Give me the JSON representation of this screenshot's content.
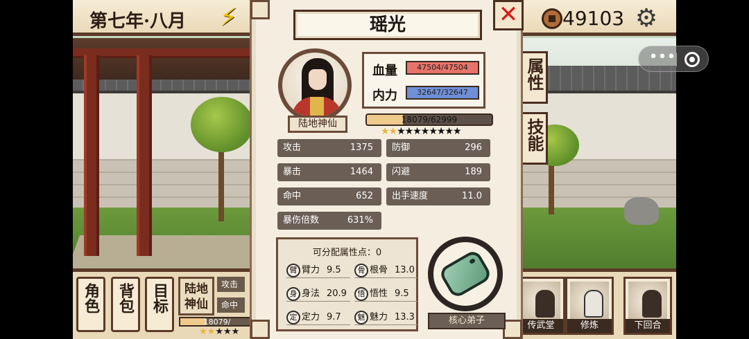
{
  "top_bar": {
    "date": "第七年·八月",
    "money": "49103"
  },
  "side_tabs": {
    "attributes": "属性",
    "skills": "技能"
  },
  "bottom_bar": {
    "role": "角色",
    "bag": "背包",
    "goal": "目标",
    "rank": "陆地神仙",
    "mini_stats": [
      "攻击",
      "命中"
    ],
    "mini_exp": "18079/",
    "menu": [
      {
        "label": "传武堂"
      },
      {
        "label": "修炼"
      },
      {
        "label": "下回合"
      }
    ]
  },
  "character": {
    "name": "瑶光",
    "rank": "陆地神仙",
    "hp_label": "血量",
    "hp": "47504/47504",
    "mp_label": "内力",
    "mp": "32647/32647",
    "exp": "18079/62999",
    "exp_fraction": 0.287,
    "stars_filled": 2,
    "stars_total": 10,
    "tag": "核心弟子"
  },
  "stats": [
    {
      "label": "攻击",
      "value": "1375"
    },
    {
      "label": "防御",
      "value": "296"
    },
    {
      "label": "暴击",
      "value": "1464"
    },
    {
      "label": "闪避",
      "value": "189"
    },
    {
      "label": "命中",
      "value": "652"
    },
    {
      "label": "出手速度",
      "value": "11.0"
    },
    {
      "label": "暴伤倍数",
      "value": "631%"
    }
  ],
  "allocation": {
    "title": "可分配属性点：0",
    "attrs": [
      {
        "label": "臂力",
        "value": "9.5"
      },
      {
        "label": "根骨",
        "value": "13.0"
      },
      {
        "label": "身法",
        "value": "20.9"
      },
      {
        "label": "悟性",
        "value": "9.5"
      },
      {
        "label": "定力",
        "value": "9.7"
      },
      {
        "label": "魅力",
        "value": "13.3"
      }
    ]
  },
  "colors": {
    "hp": "#e8736a",
    "mp": "#6f8fd6",
    "frame": "#6b4a3a",
    "accent": "#f0c98d"
  },
  "icons": {
    "energy": "lightning-icon",
    "coin": "coin-icon",
    "settings": "gear-icon",
    "close": "close-icon",
    "capsule_more": "more-dots-icon",
    "capsule_close": "record-icon"
  }
}
